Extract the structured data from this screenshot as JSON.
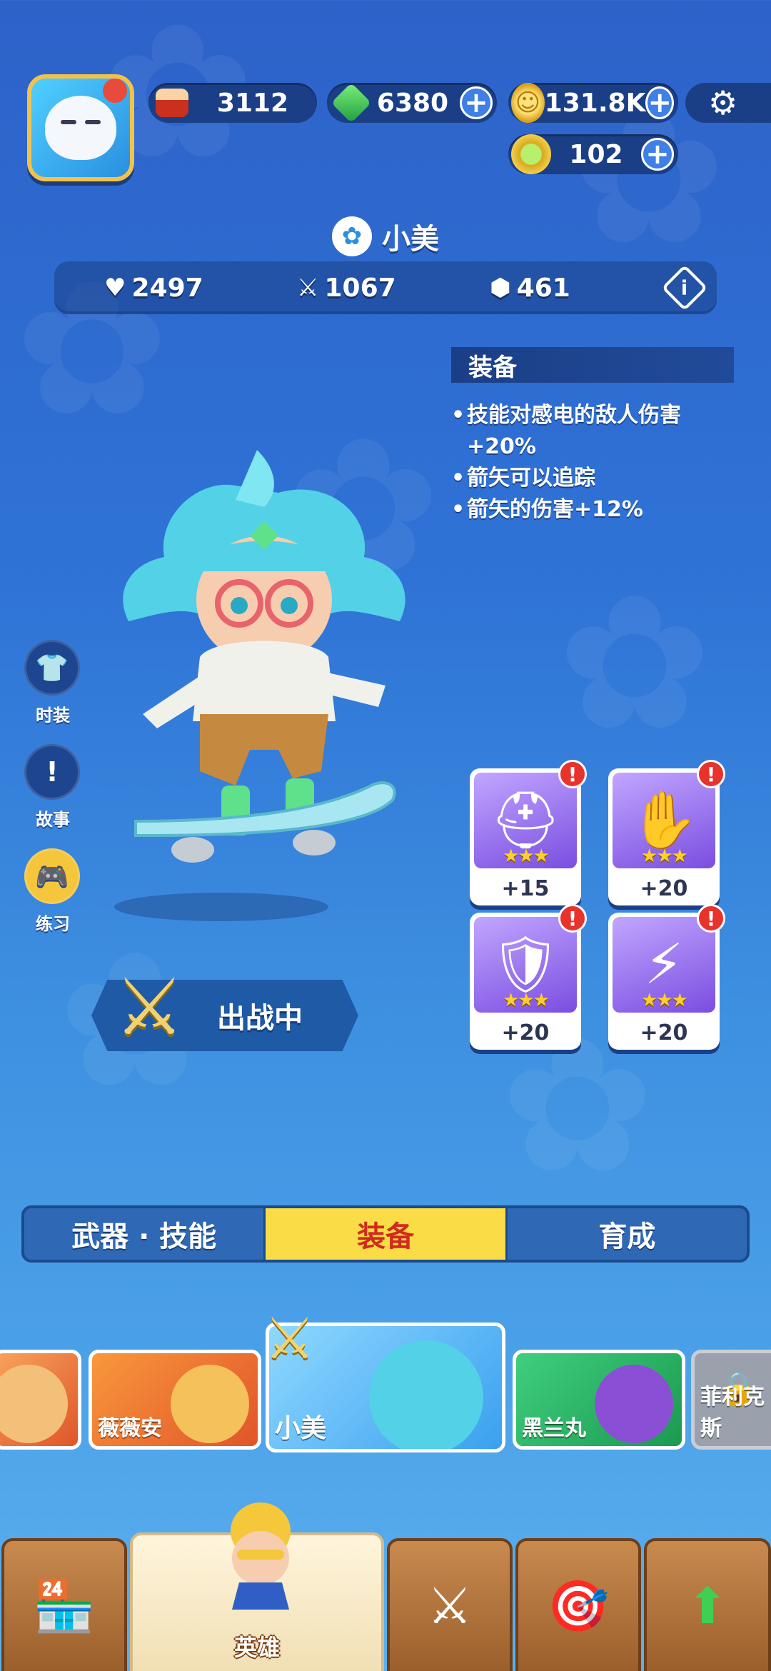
{
  "resources": {
    "cake": {
      "value": "3112",
      "icon": "cake-icon"
    },
    "gems": {
      "value": "6380",
      "icon": "gem-icon"
    },
    "coins": {
      "value": "131.8K",
      "icon": "coin-icon"
    },
    "tokens": {
      "value": "102",
      "icon": "token-icon"
    }
  },
  "hero": {
    "name": "小美",
    "element_icon": "flower-element-icon",
    "stats": {
      "hp": "2497",
      "attack": "1067",
      "defense": "461"
    }
  },
  "equipment_panel": {
    "title": "装备",
    "lines": [
      "技能对感电的敌人伤害",
      "+20%",
      "箭矢可以追踪",
      "箭矢的伤害+12%"
    ]
  },
  "side_buttons": [
    {
      "label": "时装",
      "icon": "shirt-icon"
    },
    {
      "label": "故事",
      "icon": "story-icon"
    },
    {
      "label": "练习",
      "icon": "gamepad-icon"
    }
  ],
  "battle_label": "出战中",
  "equipment_cards": [
    {
      "level": "+15",
      "icon": "helmet-icon",
      "alert": "!"
    },
    {
      "level": "+20",
      "icon": "gauntlet-icon",
      "alert": "!"
    },
    {
      "level": "+20",
      "icon": "armor-icon",
      "alert": "!"
    },
    {
      "level": "+20",
      "icon": "boots-icon",
      "alert": "!"
    }
  ],
  "tabs": [
    {
      "label": "武器 · 技能",
      "active": false
    },
    {
      "label": "装备",
      "active": true
    },
    {
      "label": "育成",
      "active": false
    }
  ],
  "heroes": [
    {
      "name": ""
    },
    {
      "name": "薇薇安"
    },
    {
      "name": "小美"
    },
    {
      "name": "黑兰丸"
    },
    {
      "name": "菲利克斯"
    }
  ],
  "nav": {
    "items": [
      {
        "label": "",
        "icon": "shop-icon"
      },
      {
        "label": "英雄",
        "icon": "hero-icon"
      },
      {
        "label": "",
        "icon": "battle-shield-icon"
      },
      {
        "label": "",
        "icon": "target-icon"
      },
      {
        "label": "",
        "icon": "upgrade-arrow-icon"
      }
    ]
  },
  "colors": {
    "accent": "#f9dc46",
    "alert": "#e8322b",
    "panel": "#1b3f86"
  }
}
